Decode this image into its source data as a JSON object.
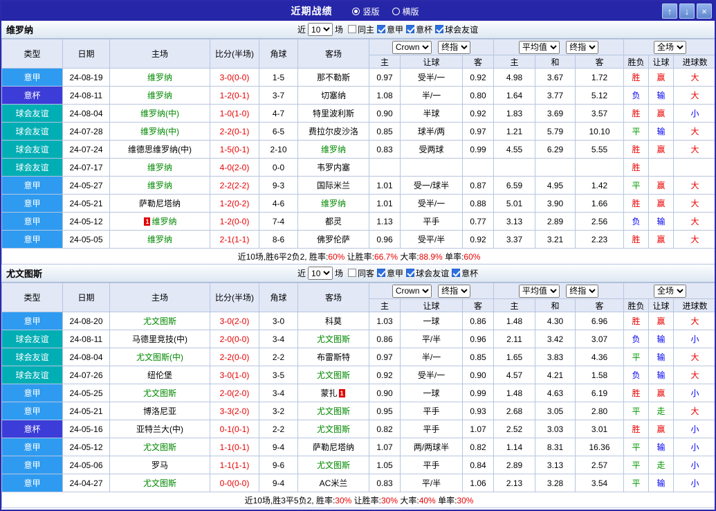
{
  "title_bar": {
    "title": "近期战绩",
    "view_modes": [
      {
        "label": "竖版",
        "selected": true
      },
      {
        "label": "横版",
        "selected": false
      }
    ],
    "window_buttons": [
      {
        "name": "scroll-up",
        "glyph": "↑"
      },
      {
        "name": "scroll-down",
        "glyph": "↓"
      },
      {
        "name": "close",
        "glyph": "×"
      }
    ]
  },
  "filters_shared": {
    "recent_prefix": "近",
    "recent_suffix": "场"
  },
  "columns": {
    "type": "类型",
    "date": "日期",
    "home": "主场",
    "score_half": "比分(半场)",
    "corner": "角球",
    "away": "客场",
    "asian_sub": [
      "主",
      "让球",
      "客"
    ],
    "euro_sub": [
      "主",
      "和",
      "客"
    ],
    "result_sub": [
      "胜负",
      "让球",
      "进球数"
    ]
  },
  "dropdowns": {
    "bookmaker": "Crown",
    "asian_final": "终指",
    "euro_avg": "平均值",
    "euro_final": "终指",
    "scope": "全场"
  },
  "league_colors": {
    "意甲": "#2E9BF0",
    "意杯": "#3C3CD9",
    "球会友谊": "#00AEB4"
  },
  "result_colors": {
    "胜": "#E80000",
    "平": "#009900",
    "负": "#0000EE",
    "赢": "#E80000",
    "走": "#009900",
    "输": "#0000EE",
    "大": "#E80000",
    "小": "#0000EE"
  },
  "accent_colors": {
    "titlebar": "#2626A8",
    "team_self": "#008800",
    "score": "#E80000",
    "header_bg": "#E2E8F6",
    "grid_border": "#B7C5E0"
  },
  "sections": [
    {
      "team": "维罗纳",
      "recent_value": "10",
      "checkboxes": [
        {
          "label": "同主",
          "checked": false
        },
        {
          "label": "意甲",
          "checked": true
        },
        {
          "label": "意杯",
          "checked": true
        },
        {
          "label": "球会友谊",
          "checked": true
        }
      ],
      "rows": [
        {
          "league": "意甲",
          "date": "24-08-19",
          "home": "维罗纳",
          "home_self": true,
          "score": "3-0(0-0)",
          "corner": "1-5",
          "away": "那不勒斯",
          "asian": [
            "0.97",
            "受半/一",
            "0.92"
          ],
          "euro": [
            "4.98",
            "3.67",
            "1.72"
          ],
          "result": [
            "胜",
            "赢",
            "大"
          ]
        },
        {
          "league": "意杯",
          "date": "24-08-11",
          "home": "维罗纳",
          "home_self": true,
          "score": "1-2(0-1)",
          "corner": "3-7",
          "away": "切塞纳",
          "asian": [
            "1.08",
            "半/一",
            "0.80"
          ],
          "euro": [
            "1.64",
            "3.77",
            "5.12"
          ],
          "result": [
            "负",
            "输",
            "大"
          ]
        },
        {
          "league": "球会友谊",
          "date": "24-08-04",
          "home": "维罗纳(中)",
          "home_self": true,
          "score": "1-0(1-0)",
          "corner": "4-7",
          "away": "特里波利斯",
          "asian": [
            "0.90",
            "半球",
            "0.92"
          ],
          "euro": [
            "1.83",
            "3.69",
            "3.57"
          ],
          "result": [
            "胜",
            "赢",
            "小"
          ]
        },
        {
          "league": "球会友谊",
          "date": "24-07-28",
          "home": "维罗纳(中)",
          "home_self": true,
          "score": "2-2(0-1)",
          "corner": "6-5",
          "away": "费拉尔皮沙洛",
          "asian": [
            "0.85",
            "球半/两",
            "0.97"
          ],
          "euro": [
            "1.21",
            "5.79",
            "10.10"
          ],
          "result": [
            "平",
            "输",
            "大"
          ]
        },
        {
          "league": "球会友谊",
          "date": "24-07-24",
          "home": "维德思维罗纳(中)",
          "score": "1-5(0-1)",
          "corner": "2-10",
          "away": "维罗纳",
          "away_self": true,
          "asian": [
            "0.83",
            "受两球",
            "0.99"
          ],
          "euro": [
            "4.55",
            "6.29",
            "5.55"
          ],
          "result": [
            "胜",
            "赢",
            "大"
          ]
        },
        {
          "league": "球会友谊",
          "date": "24-07-17",
          "home": "维罗纳",
          "home_self": true,
          "score": "4-0(2-0)",
          "corner": "0-0",
          "away": "韦罗内塞",
          "asian": [
            "",
            "",
            ""
          ],
          "euro": [
            "",
            "",
            ""
          ],
          "result": [
            "胜",
            "",
            ""
          ]
        },
        {
          "league": "意甲",
          "date": "24-05-27",
          "home": "维罗纳",
          "home_self": true,
          "score": "2-2(2-2)",
          "corner": "9-3",
          "away": "国际米兰",
          "asian": [
            "1.01",
            "受一/球半",
            "0.87"
          ],
          "euro": [
            "6.59",
            "4.95",
            "1.42"
          ],
          "result": [
            "平",
            "赢",
            "大"
          ]
        },
        {
          "league": "意甲",
          "date": "24-05-21",
          "home": "萨勒尼塔纳",
          "score": "1-2(0-2)",
          "corner": "4-6",
          "away": "维罗纳",
          "away_self": true,
          "asian": [
            "1.01",
            "受半/一",
            "0.88"
          ],
          "euro": [
            "5.01",
            "3.90",
            "1.66"
          ],
          "result": [
            "胜",
            "赢",
            "大"
          ]
        },
        {
          "league": "意甲",
          "date": "24-05-12",
          "home": "维罗纳",
          "home_self": true,
          "home_card": 1,
          "score": "1-2(0-0)",
          "corner": "7-4",
          "away": "都灵",
          "asian": [
            "1.13",
            "平手",
            "0.77"
          ],
          "euro": [
            "3.13",
            "2.89",
            "2.56"
          ],
          "result": [
            "负",
            "输",
            "大"
          ]
        },
        {
          "league": "意甲",
          "date": "24-05-05",
          "home": "维罗纳",
          "home_self": true,
          "score": "2-1(1-1)",
          "corner": "8-6",
          "away": "佛罗伦萨",
          "asian": [
            "0.96",
            "受平/半",
            "0.92"
          ],
          "euro": [
            "3.37",
            "3.21",
            "2.23"
          ],
          "result": [
            "胜",
            "赢",
            "大"
          ]
        }
      ],
      "summary": [
        {
          "text": "近10场,胜6平2负2, ",
          "red": false
        },
        {
          "text": "胜率:",
          "red": false
        },
        {
          "text": "60%",
          "red": true
        },
        {
          "text": " 让胜率:",
          "red": false
        },
        {
          "text": "66.7%",
          "red": true
        },
        {
          "text": " 大率:",
          "red": false
        },
        {
          "text": "88.9%",
          "red": true
        },
        {
          "text": " 单率:",
          "red": false
        },
        {
          "text": "60%",
          "red": true
        }
      ]
    },
    {
      "team": "尤文图斯",
      "recent_value": "10",
      "checkboxes": [
        {
          "label": "同客",
          "checked": false
        },
        {
          "label": "意甲",
          "checked": true
        },
        {
          "label": "球会友谊",
          "checked": true
        },
        {
          "label": "意杯",
          "checked": true
        }
      ],
      "rows": [
        {
          "league": "意甲",
          "date": "24-08-20",
          "home": "尤文图斯",
          "home_self": true,
          "score": "3-0(2-0)",
          "corner": "3-0",
          "away": "科莫",
          "asian": [
            "1.03",
            "一球",
            "0.86"
          ],
          "euro": [
            "1.48",
            "4.30",
            "6.96"
          ],
          "result": [
            "胜",
            "赢",
            "大"
          ]
        },
        {
          "league": "球会友谊",
          "date": "24-08-11",
          "home": "马德里竞技(中)",
          "score": "2-0(0-0)",
          "corner": "3-4",
          "away": "尤文图斯",
          "away_self": true,
          "asian": [
            "0.86",
            "平/半",
            "0.96"
          ],
          "euro": [
            "2.11",
            "3.42",
            "3.07"
          ],
          "result": [
            "负",
            "输",
            "小"
          ]
        },
        {
          "league": "球会友谊",
          "date": "24-08-04",
          "home": "尤文图斯(中)",
          "home_self": true,
          "score": "2-2(0-0)",
          "corner": "2-2",
          "away": "布雷斯特",
          "asian": [
            "0.97",
            "半/一",
            "0.85"
          ],
          "euro": [
            "1.65",
            "3.83",
            "4.36"
          ],
          "result": [
            "平",
            "输",
            "大"
          ]
        },
        {
          "league": "球会友谊",
          "date": "24-07-26",
          "home": "纽伦堡",
          "score": "3-0(1-0)",
          "corner": "3-5",
          "away": "尤文图斯",
          "away_self": true,
          "asian": [
            "0.92",
            "受半/一",
            "0.90"
          ],
          "euro": [
            "4.57",
            "4.21",
            "1.58"
          ],
          "result": [
            "负",
            "输",
            "大"
          ]
        },
        {
          "league": "意甲",
          "date": "24-05-25",
          "home": "尤文图斯",
          "home_self": true,
          "score": "2-0(2-0)",
          "corner": "3-4",
          "away": "蒙扎",
          "away_card": 1,
          "asian": [
            "0.90",
            "一球",
            "0.99"
          ],
          "euro": [
            "1.48",
            "4.63",
            "6.19"
          ],
          "result": [
            "胜",
            "赢",
            "小"
          ]
        },
        {
          "league": "意甲",
          "date": "24-05-21",
          "home": "博洛尼亚",
          "score": "3-3(2-0)",
          "corner": "3-2",
          "away": "尤文图斯",
          "away_self": true,
          "asian": [
            "0.95",
            "平手",
            "0.93"
          ],
          "euro": [
            "2.68",
            "3.05",
            "2.80"
          ],
          "result": [
            "平",
            "走",
            "大"
          ]
        },
        {
          "league": "意杯",
          "date": "24-05-16",
          "home": "亚特兰大(中)",
          "score": "0-1(0-1)",
          "corner": "2-2",
          "away": "尤文图斯",
          "away_self": true,
          "asian": [
            "0.82",
            "平手",
            "1.07"
          ],
          "euro": [
            "2.52",
            "3.03",
            "3.01"
          ],
          "result": [
            "胜",
            "赢",
            "小"
          ]
        },
        {
          "league": "意甲",
          "date": "24-05-12",
          "home": "尤文图斯",
          "home_self": true,
          "score": "1-1(0-1)",
          "corner": "9-4",
          "away": "萨勒尼塔纳",
          "asian": [
            "1.07",
            "两/两球半",
            "0.82"
          ],
          "euro": [
            "1.14",
            "8.31",
            "16.36"
          ],
          "result": [
            "平",
            "输",
            "小"
          ]
        },
        {
          "league": "意甲",
          "date": "24-05-06",
          "home": "罗马",
          "score": "1-1(1-1)",
          "corner": "9-6",
          "away": "尤文图斯",
          "away_self": true,
          "asian": [
            "1.05",
            "平手",
            "0.84"
          ],
          "euro": [
            "2.89",
            "3.13",
            "2.57"
          ],
          "result": [
            "平",
            "走",
            "小"
          ]
        },
        {
          "league": "意甲",
          "date": "24-04-27",
          "home": "尤文图斯",
          "home_self": true,
          "score": "0-0(0-0)",
          "corner": "9-4",
          "away": "AC米兰",
          "asian": [
            "0.83",
            "平/半",
            "1.06"
          ],
          "euro": [
            "2.13",
            "3.28",
            "3.54"
          ],
          "result": [
            "平",
            "输",
            "小"
          ]
        }
      ],
      "summary": [
        {
          "text": "近10场,胜3平5负2, ",
          "red": false
        },
        {
          "text": "胜率:",
          "red": false
        },
        {
          "text": "30%",
          "red": true
        },
        {
          "text": " 让胜率:",
          "red": false
        },
        {
          "text": "30%",
          "red": true
        },
        {
          "text": " 大率:",
          "red": false
        },
        {
          "text": "40%",
          "red": true
        },
        {
          "text": " 单率:",
          "red": false
        },
        {
          "text": "30%",
          "red": true
        }
      ]
    }
  ]
}
